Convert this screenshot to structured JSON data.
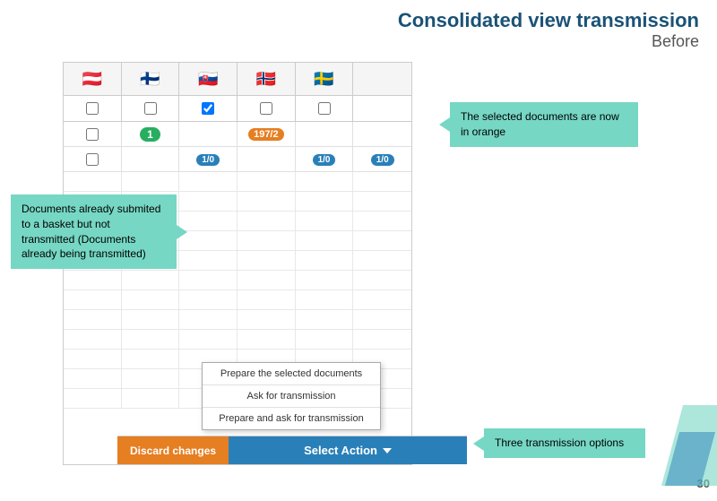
{
  "title": {
    "main": "Consolidated view transmission",
    "sub": "Before"
  },
  "table": {
    "flags": [
      "🇦🇹",
      "🇫🇮",
      "🇸🇰",
      "🇳🇴",
      "🇸🇪"
    ],
    "check_row": [
      "checkbox",
      "checkbox",
      "checked",
      "checkbox",
      "checkbox"
    ],
    "row1": {
      "col1": "1",
      "col2": "",
      "col3": "197/2",
      "col4": "",
      "col5": ""
    },
    "row2": {
      "col1": "",
      "col2": "1/0",
      "col3": "",
      "col4": "1/0",
      "col5": "1/0"
    }
  },
  "callouts": {
    "orange_docs": "The selected documents are now in orange",
    "docs_already": "Documents already submited to a basket but not transmitted (Documents already being transmitted)",
    "three_options": "Three transmission options"
  },
  "dropdown": {
    "item1": "Prepare the selected documents",
    "item2": "Ask for transmission",
    "item3": "Prepare and ask for transmission"
  },
  "buttons": {
    "discard": "Discard changes",
    "select_action": "Select Action"
  },
  "page_number": "30"
}
